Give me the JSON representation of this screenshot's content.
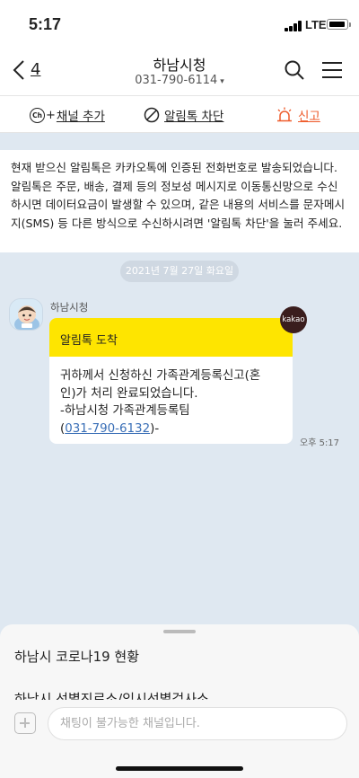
{
  "status_bar": {
    "time": "5:17",
    "network": "LTE"
  },
  "header": {
    "back_count": "4",
    "title": "하남시청",
    "subtitle": "031-790-6114",
    "caret": "▾"
  },
  "actions": {
    "channel_badge": "Ch",
    "channel_plus": "+",
    "channel_label": "채널 추가",
    "block_label": "알림톡 차단",
    "report_label": "신고",
    "report_color": "#ee5a2a"
  },
  "notice": {
    "text": "현재 받으신 알림톡은 카카오톡에 인증된 전화번호로 발송되었습니다. 알림톡은 주문, 배송, 결제 등의 정보성 메시지로 이동통신망으로 수신하시면 데이터요금이 발생할 수 있으며, 같은 내용의 서비스를 문자메시지(SMS) 등 다른 방식으로 수신하시려면 '알림톡 차단'을 눌러 주세요."
  },
  "chat": {
    "date": "2021년 7월 27일 화요일",
    "sender": "하남시청",
    "kakao_badge": "kakao",
    "message": {
      "header": "알림톡 도착",
      "line1": "귀하께서 신청하신 가족관계등록신고(혼",
      "line2": "인)가 처리 완료되었습니다.",
      "line3": "-하남시청 가족관계등록팀",
      "phone_open": "(",
      "phone": "031-790-6132",
      "phone_close": ")-"
    },
    "time": "오후 5:17",
    "bubble_header_color": "#fee500",
    "background_color": "#dfe8f1"
  },
  "bottom_sheet": {
    "items": [
      "하남시 코로나19 현황",
      "하남시 선별진료소/임시선별검사소"
    ],
    "input_placeholder": "채팅이 불가능한 채널입니다."
  },
  "icons": {
    "back": "back-chevron-icon",
    "search": "search-icon",
    "menu": "hamburger-menu-icon",
    "block": "block-icon",
    "report": "siren-icon",
    "attach": "plus-square-icon"
  }
}
